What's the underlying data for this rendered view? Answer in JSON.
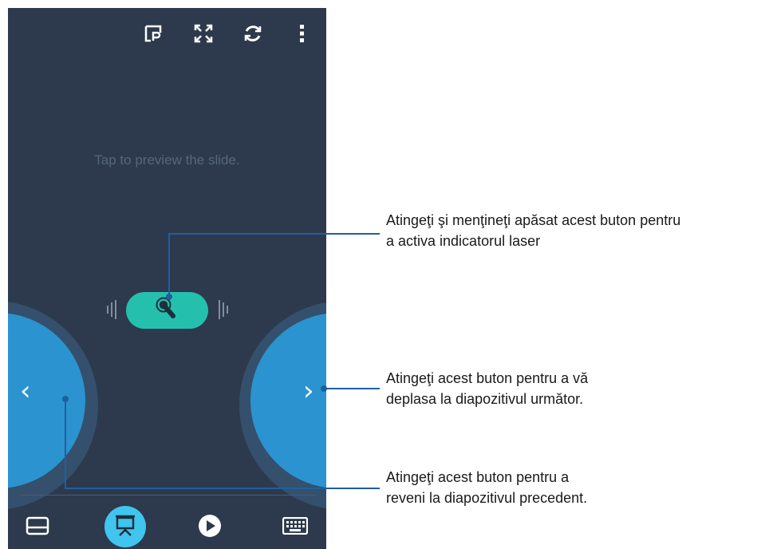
{
  "app": {
    "preview_hint": "Tap to preview the slide."
  },
  "topbar": {
    "icons": [
      "presenter-view-icon",
      "fullscreen-icon",
      "refresh-icon",
      "more-vert-icon"
    ]
  },
  "navigation": {
    "prev_glyph": "‹",
    "next_glyph": "›"
  },
  "bottom_bar": {
    "icons": [
      "touchpad-icon",
      "presentation-icon",
      "play-icon",
      "keyboard-icon"
    ],
    "active_color": "#3fc5ee"
  },
  "callouts": {
    "laser_line1": "Atingeţi şi menţineţi apăsat acest buton pentru",
    "laser_line2": "a activa indicatorul laser",
    "next_line1": "Atingeţi acest buton pentru a vă",
    "next_line2": "deplasa la diapozitivul următor.",
    "prev_line1": "Atingeţi acest buton pentru a",
    "prev_line2": "reveni la diapozitivul precedent."
  },
  "colors": {
    "background": "#2d3a4d",
    "nav_button": "#2b93cf",
    "laser_button": "#24c0ad",
    "leader_line": "#1f5fa0"
  }
}
